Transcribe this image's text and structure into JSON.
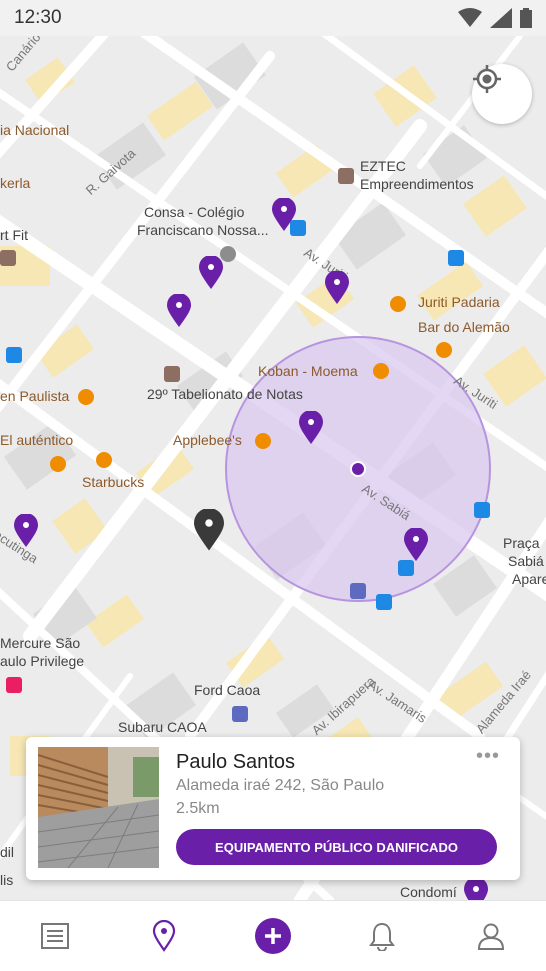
{
  "status_bar": {
    "time": "12:30"
  },
  "map": {
    "labels": {
      "r_gaivota": "R. Gaivota",
      "canario": "Canário",
      "nacional": "ia Nacional",
      "kerla": "kerla",
      "rt_fit": "rt Fit",
      "eztec_1": "EZTEC",
      "eztec_2": "Empreendimentos",
      "consa_1": "Consa - Colégio",
      "consa_2": "Franciscano Nossa...",
      "av_juriti_1": "Av. Juriti",
      "av_juriti_2": "Av. Juriti",
      "juriti_padaria": "Juriti Padaria",
      "bar_alemao": "Bar do Alemão",
      "koban": "Koban - Moema",
      "tabelionato": "29º Tabelionato de Notas",
      "en_paulista": "en Paulista",
      "el_autentico": "El auténtico",
      "applebees": "Applebee's",
      "starbucks": "Starbucks",
      "av_sabia": "Av. Sabiá",
      "acutinga": "acutinga",
      "praca_1": "Praça",
      "praca_2": "Sabiá",
      "praca_3": "Apare",
      "mercure_1": "Mercure São",
      "mercure_2": "aulo Privilege",
      "av_ibirapuera": "Av. Ibirapuera",
      "av_jamaris": "Av. Jamaris",
      "alameda_irae": "Alameda Iraé",
      "ford": "Ford Caoa",
      "subaru": "Subaru CAOA",
      "condomi": "Condomí",
      "dil": "dil",
      "lis": "lis"
    },
    "pin_color": "#6a1fa8",
    "selected_pin_color": "#3a3a3a",
    "radius_fill": "#d8c8ee"
  },
  "card": {
    "name": "Paulo Santos",
    "address": "Alameda iraé 242, São Paulo",
    "distance": "2.5km",
    "tag": "EQUIPAMENTO PÚBLICO DANIFICADO",
    "more": "•••"
  },
  "bottom_nav": {
    "items": [
      "list-icon",
      "map-pin-icon",
      "add-icon",
      "bell-icon",
      "profile-icon"
    ],
    "active_color": "#6a1fa8"
  }
}
